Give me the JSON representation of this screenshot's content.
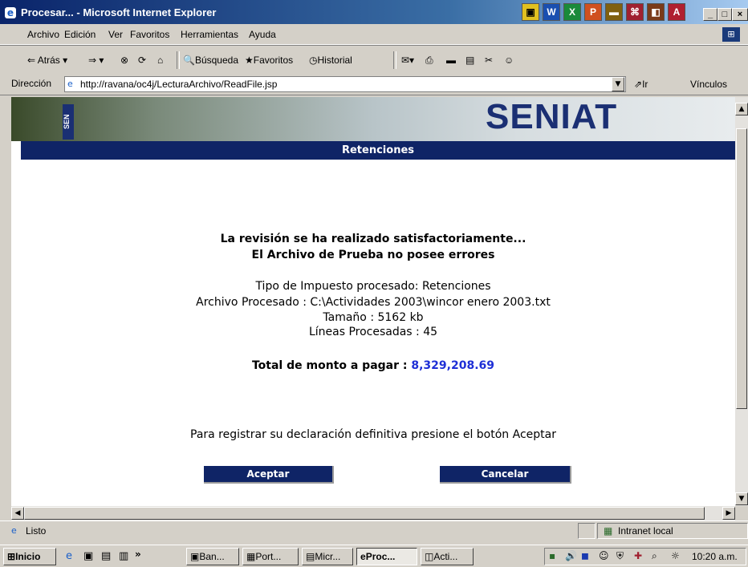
{
  "window": {
    "title": "Procesar... - Microsoft Internet Explorer"
  },
  "menu": [
    "Archivo",
    "Edición",
    "Ver",
    "Favoritos",
    "Herramientas",
    "Ayuda"
  ],
  "toolbar": {
    "back": "Atrás",
    "search": "Búsqueda",
    "favorites": "Favoritos",
    "history": "Historial"
  },
  "address": {
    "label": "Dirección",
    "url": "http://ravana/oc4j/LecturaArchivo/ReadFile.jsp",
    "go": "Ir",
    "links": "Vínculos"
  },
  "banner": {
    "logo_text": "SENIAT",
    "side_text": "SEN"
  },
  "page": {
    "header": "Retenciones",
    "msg1": "La revisión se ha realizado satisfactoriamente...",
    "msg2": "El Archivo de Prueba no posee errores",
    "tax_type": "Tipo de Impuesto procesado: Retenciones",
    "file": "Archivo Procesado : C:\\Actividades 2003\\wincor enero 2003.txt",
    "size": "Tamaño : 5162 kb",
    "lines": "Líneas Procesadas : 45",
    "total_label": "Total de monto a pagar :",
    "total_value": "8,329,208.69",
    "instruction": "Para registrar su declaración definitiva presione el botón Aceptar",
    "accept": "Aceptar",
    "cancel": "Cancelar"
  },
  "status": {
    "text": "Listo",
    "zone": "Intranet local"
  },
  "taskbar": {
    "start": "Inicio",
    "tasks": [
      "Ban...",
      "Port...",
      "Micr...",
      "Proc...",
      "Acti..."
    ],
    "clock": "10:20 a.m."
  }
}
